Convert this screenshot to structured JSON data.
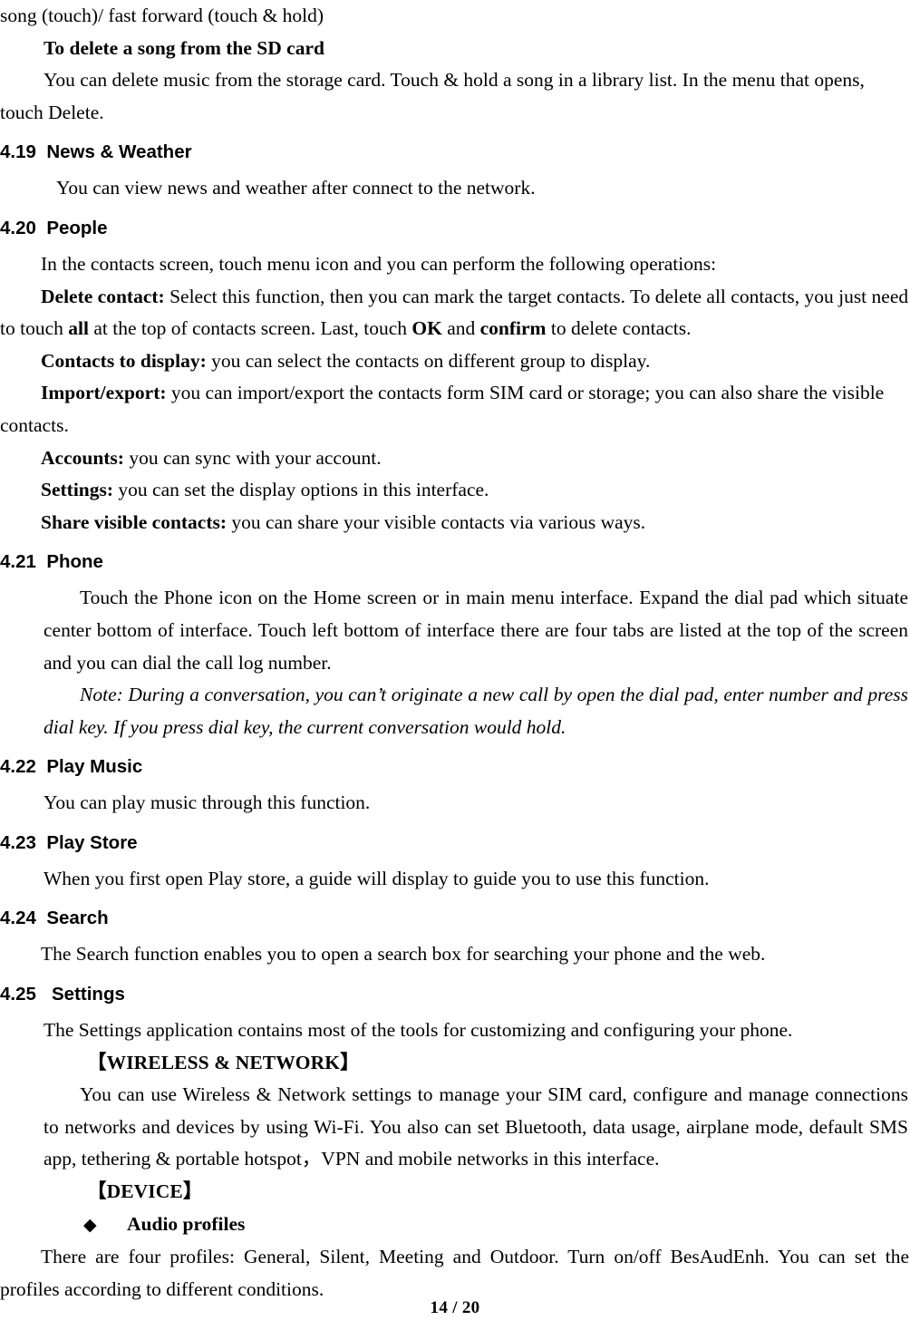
{
  "document": {
    "footer": "14 / 20",
    "continued_line": "song (touch)/ fast forward (touch & hold)"
  },
  "music_section": {
    "subheading": "To delete a song from the SD card",
    "paragraph": "You can delete music from the storage card. Touch & hold a song in a library list. In the menu that opens, touch Delete."
  },
  "sections": {
    "news_weather": {
      "number": "4.19",
      "title": "News & Weather",
      "paragraph": "You can view news and weather after connect to the network."
    },
    "people": {
      "number": "4.20",
      "title": "People",
      "intro": "In the contacts screen, touch menu icon and you can perform the following operations:",
      "items": [
        {
          "label": "Delete contact:",
          "text_1": " Select this function, then you can mark the target contacts. To delete all contacts, you just need to touch ",
          "bold_1": "all",
          "text_2": " at the top of contacts screen. Last, touch ",
          "bold_2": "OK",
          "text_3": " and ",
          "bold_3": "confirm",
          "text_4": " to delete contacts."
        },
        {
          "label": "Contacts to display:",
          "text": " you can select the contacts on different group to display."
        },
        {
          "label": "Import/export:",
          "text": " you can import/export the contacts form SIM card or storage; you can also share the visible contacts."
        },
        {
          "label": "Accounts:",
          "text": " you can sync with your account."
        },
        {
          "label": "Settings:",
          "text": " you can set the display options in this interface."
        },
        {
          "label": "Share visible contacts:",
          "text": " you can share your visible contacts via various ways."
        }
      ]
    },
    "phone": {
      "number": "4.21",
      "title": "Phone",
      "paragraph": "Touch the Phone icon on the Home screen or in main menu interface. Expand the dial pad which situate center bottom of interface. Touch left bottom of interface there are four tabs are listed at the top of the screen and you can dial the call log number.",
      "note": "Note: During a conversation, you can’t originate a new call by open the dial pad, enter number and press dial key. If you press dial key, the current conversation would hold."
    },
    "play_music": {
      "number": "4.22",
      "title": "Play Music",
      "paragraph": "You can play music through this function."
    },
    "play_store": {
      "number": "4.23",
      "title": "Play Store",
      "paragraph": "When you first open  Play store, a guide will display to guide you to use this function."
    },
    "search": {
      "number": "4.24",
      "title": "Search",
      "paragraph": "The Search function enables you to open a search box for searching your phone and the web."
    },
    "settings": {
      "number": "4.25",
      "title": "Settings",
      "paragraph": "The Settings application contains most of the tools for customizing and configuring your phone.",
      "wireless_heading": "【WIRELESS & NETWORK】",
      "wireless_paragraph": "You can use Wireless & Network settings to manage your SIM card, configure and manage connections to networks and devices by using Wi-Fi. You also can set Bluetooth, data usage, airplane mode, default SMS app, tethering & portable hotspot，VPN and mobile networks in this interface.",
      "device_heading": "【DEVICE】",
      "audio_profiles": {
        "bullet": "◆",
        "label": "Audio profiles",
        "paragraph": "There are four profiles: General, Silent, Meeting and Outdoor. Turn on/off BesAudEnh. You can set the profiles according to different conditions."
      }
    }
  }
}
